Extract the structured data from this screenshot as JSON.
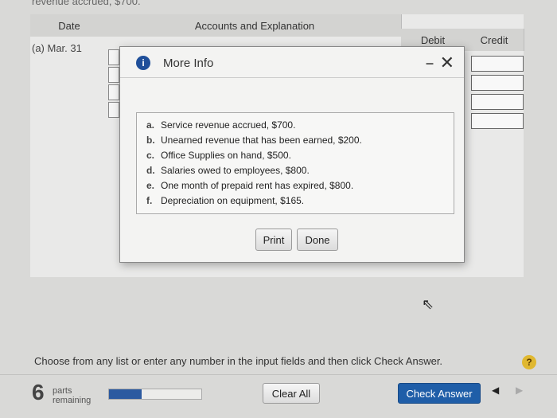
{
  "top_cut_text": "revenue accrued, $700.",
  "table": {
    "headers": {
      "date": "Date",
      "accounts": "Accounts and Explanation",
      "debit": "Debit",
      "credit": "Credit"
    },
    "row_date": "(a) Mar. 31"
  },
  "modal": {
    "icon": "info-icon",
    "title": "More Info",
    "items": [
      {
        "letter": "a.",
        "text": "Service revenue accrued, $700."
      },
      {
        "letter": "b.",
        "text": "Unearned revenue that has been earned, $200."
      },
      {
        "letter": "c.",
        "text": "Office Supplies on hand, $500."
      },
      {
        "letter": "d.",
        "text": "Salaries owed to employees, $800."
      },
      {
        "letter": "e.",
        "text": "One month of prepaid rent has expired, $800."
      },
      {
        "letter": "f.",
        "text": "Depreciation on equipment, $165."
      }
    ],
    "print_label": "Print",
    "done_label": "Done"
  },
  "instructions": "Choose from any list or enter any number in the input fields and then click Check Answer.",
  "help_label": "?",
  "parts": {
    "count": "6",
    "label_line1": "parts",
    "label_line2": "remaining",
    "progress_fraction": 0.35
  },
  "buttons": {
    "clear_all": "Clear All",
    "check_answer": "Check Answer"
  },
  "colors": {
    "primary": "#1f5ea8",
    "info": "#1f4f9a",
    "help": "#e0b830"
  }
}
